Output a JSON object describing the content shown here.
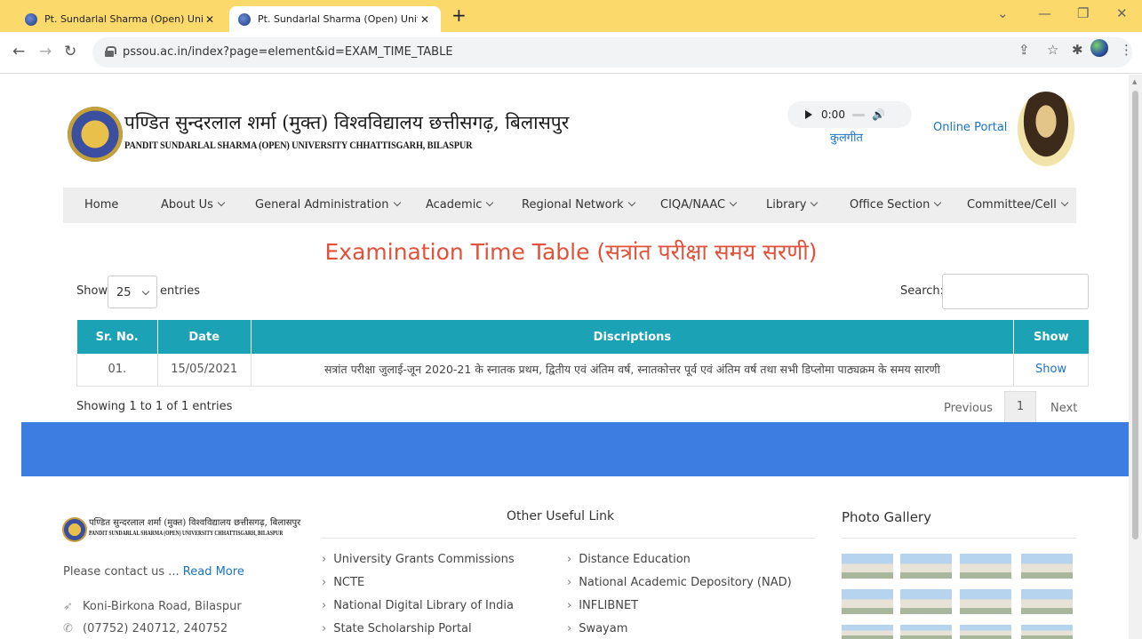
{
  "browser": {
    "tabs": [
      {
        "title": "Pt. Sundarlal Sharma (Open) Univ",
        "active": false
      },
      {
        "title": "Pt. Sundarlal Sharma (Open) Univ",
        "active": true
      }
    ],
    "new_tab": "+",
    "url": "pssou.ac.in/index?page=element&id=EXAM_TIME_TABLE"
  },
  "header": {
    "name_hindi": "पण्डित सुन्दरलाल शर्मा (मुक्त) विश्वविद्यालय छत्तीसगढ़, बिलासपुर",
    "name_english": "PANDIT SUNDARLAL SHARMA (OPEN) UNIVERSITY CHHATTISGARH, BILASPUR",
    "audio_time": "0:00",
    "kulgeet": "कुलगीत",
    "online_portal": "Online Portal"
  },
  "nav": [
    {
      "label": "Home",
      "dropdown": false
    },
    {
      "label": "About Us",
      "dropdown": true
    },
    {
      "label": "General Administration",
      "dropdown": true
    },
    {
      "label": "Academic",
      "dropdown": true
    },
    {
      "label": "Regional Network",
      "dropdown": true
    },
    {
      "label": "CIQA/NAAC",
      "dropdown": true
    },
    {
      "label": "Library",
      "dropdown": true
    },
    {
      "label": "Office Section",
      "dropdown": true
    },
    {
      "label": "Committee/Cell",
      "dropdown": true
    }
  ],
  "page_heading": "Examination Time Table (सत्रांत परीक्षा समय सरणी)",
  "table_controls": {
    "show_label": "Show",
    "page_size": "25",
    "entries_label": "entries",
    "search_label": "Search:"
  },
  "table": {
    "headers": [
      "Sr. No.",
      "Date",
      "Discriptions",
      "Show"
    ],
    "rows": [
      {
        "sr": "01.",
        "date": "15/05/2021",
        "description": "सत्रांत परीक्षा जुलाई-जून 2020-21 के स्नातक प्रथम, द्वितीय एवं अंतिम वर्ष, स्नातकोत्तर पूर्व एवं अंतिम वर्ष तथा सभी डिप्लोमा पाठ्यक्रम के समय सारणी",
        "show": "Show"
      }
    ]
  },
  "pagination": {
    "info": "Showing 1 to 1 of 1 entries",
    "previous": "Previous",
    "current": "1",
    "next": "Next"
  },
  "footer": {
    "logo_hindi": "पण्डित सुन्दरलाल शर्मा (मुक्त) विश्वविद्यालय छत्तीसगढ़, बिलासपुर",
    "logo_english": "PANDIT SUNDARLAL SHARMA (OPEN) UNIVERSITY CHHATTISGARH, BILASPUR",
    "contact_text": "Please contact us ...",
    "read_more": "Read More",
    "address": "Koni-Birkona Road, Bilaspur",
    "phone": "(07752) 240712, 240752",
    "useful_title": "Other Useful Link",
    "links_col1": [
      "University Grants Commissions",
      "NCTE",
      "National Digital Library of India",
      "State Scholarship Portal"
    ],
    "links_col2": [
      "Distance Education",
      "National Academic Depository (NAD)",
      "INFLIBNET",
      "Swayam"
    ],
    "gallery_title": "Photo Gallery"
  }
}
